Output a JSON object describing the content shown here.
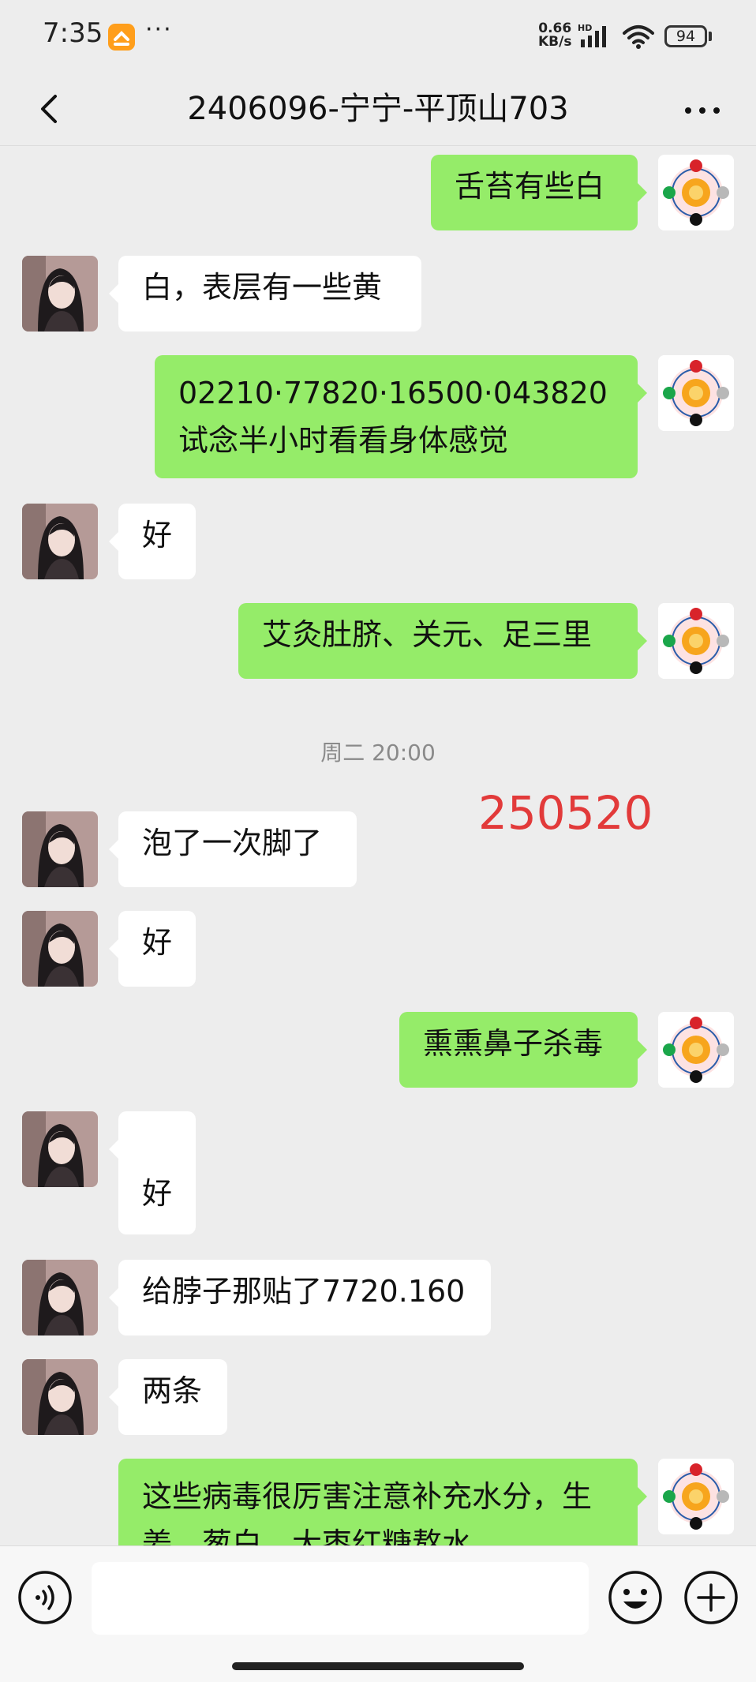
{
  "status_bar": {
    "time": "7:35",
    "more": "···",
    "net_speed_value": "0.66",
    "net_speed_unit": "KB/s",
    "hd_label": "HD",
    "battery": "94"
  },
  "header": {
    "title": "2406096-宁宁-平顶山703"
  },
  "messages": [
    {
      "side": "out",
      "text": "舌苔有些白"
    },
    {
      "side": "in",
      "text": "白，表层有一些黄"
    },
    {
      "side": "out",
      "line1": "02210·77820·16500·043820",
      "line2": "试念半小时看看身体感觉"
    },
    {
      "side": "in",
      "text": "好"
    },
    {
      "side": "out",
      "text": "艾灸肚脐、关元、足三里"
    },
    {
      "side": "in",
      "text": "泡了一次脚了"
    },
    {
      "side": "in",
      "text": "好"
    },
    {
      "side": "out",
      "text": "熏熏鼻子杀毒"
    },
    {
      "side": "in",
      "text": "好"
    },
    {
      "side": "in",
      "text": "给脖子那贴了7720.160"
    },
    {
      "side": "in",
      "text": "两条"
    },
    {
      "side": "out",
      "line1": "这些病毒很厉害注意补充水分，生",
      "line2": "姜、葱白、大枣红糖熬水"
    }
  ],
  "timestamp": "周二 20:00",
  "annotation": "250520",
  "colors": {
    "outgoing_bubble": "#95ec69",
    "incoming_bubble": "#ffffff",
    "annotation": "#e23a3a",
    "background": "#ededed"
  },
  "icons": {
    "back": "chevron-left",
    "menu": "more-horizontal",
    "voice": "voice-wave",
    "emoji": "smiley",
    "plus": "plus-circle"
  }
}
